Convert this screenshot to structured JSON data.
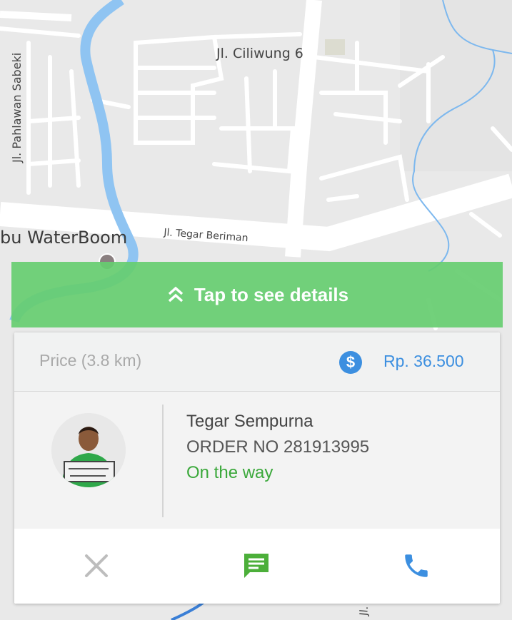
{
  "map": {
    "labels": {
      "ciliwung": "Jl. Ciliwung 6",
      "pahlawan": "Jl. Pahlawan Sabeki",
      "tegar_beriman": "Jl. Tegar Beriman",
      "waterboom": "bu WaterBoom",
      "bottom_street": "Jl."
    },
    "colors": {
      "road": "#ffffff",
      "background": "#e9e9e9",
      "river": "#8fc4f2"
    }
  },
  "tap_bar": {
    "label": "Tap to see details",
    "icon": "double-chevron-up-icon",
    "color": "#66cd70"
  },
  "card": {
    "price": {
      "label": "Price (3.8 km)",
      "icon": "dollar-icon",
      "value": "Rp. 36.500",
      "accent": "#3c8fe0"
    },
    "driver": {
      "name": "Tegar Sempurna",
      "order_no": "ORDER NO 281913995",
      "status": "On the way",
      "status_color": "#3aa83a"
    },
    "actions": [
      {
        "name": "cancel",
        "icon": "close-icon"
      },
      {
        "name": "chat",
        "icon": "chat-icon"
      },
      {
        "name": "call",
        "icon": "phone-icon"
      }
    ]
  }
}
